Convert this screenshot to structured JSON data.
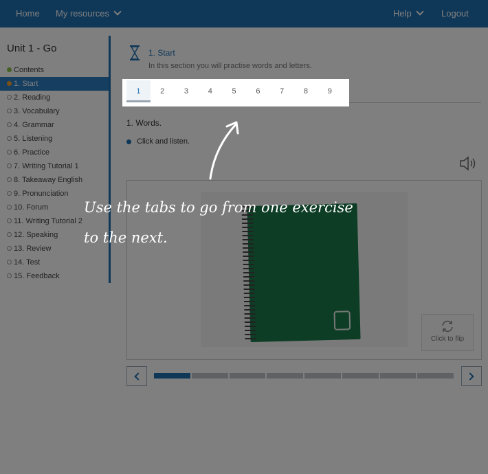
{
  "nav": {
    "home": "Home",
    "my_resources": "My resources",
    "help": "Help",
    "logout": "Logout"
  },
  "sidebar": {
    "unit_title": "Unit 1 - Go",
    "items": [
      "Contents",
      "1. Start",
      "2. Reading",
      "3. Vocabulary",
      "4. Grammar",
      "5. Listening",
      "6. Practice",
      "7. Writing Tutorial 1",
      "8. Takeaway English",
      "9. Pronunciation",
      "10. Forum",
      "11. Writing Tutorial 2",
      "12. Speaking",
      "13. Review",
      "14. Test",
      "15. Feedback"
    ],
    "active_index": 1
  },
  "section": {
    "title": "1. Start",
    "subtitle": "In this section you will practise words and letters."
  },
  "tabs": [
    "1",
    "2",
    "3",
    "4",
    "5",
    "6",
    "7",
    "8",
    "9"
  ],
  "active_tab": 0,
  "exercise": {
    "title": "1. Words.",
    "instruction": "Click and listen."
  },
  "card": {
    "flip_label": "Click to flip"
  },
  "progress": {
    "segments": 8,
    "completed": 1
  },
  "hint": {
    "line1": "Use the tabs to go from one exercise",
    "line2": "to the next."
  },
  "colors": {
    "brand": "#1e6fb0",
    "active_item": "#2b7cc2",
    "notebook": "#1c7a4c"
  },
  "icons": [
    "chevron-down-icon",
    "hourglass-icon",
    "speaker-icon",
    "flip-icon",
    "chevron-left-icon",
    "chevron-right-icon"
  ]
}
